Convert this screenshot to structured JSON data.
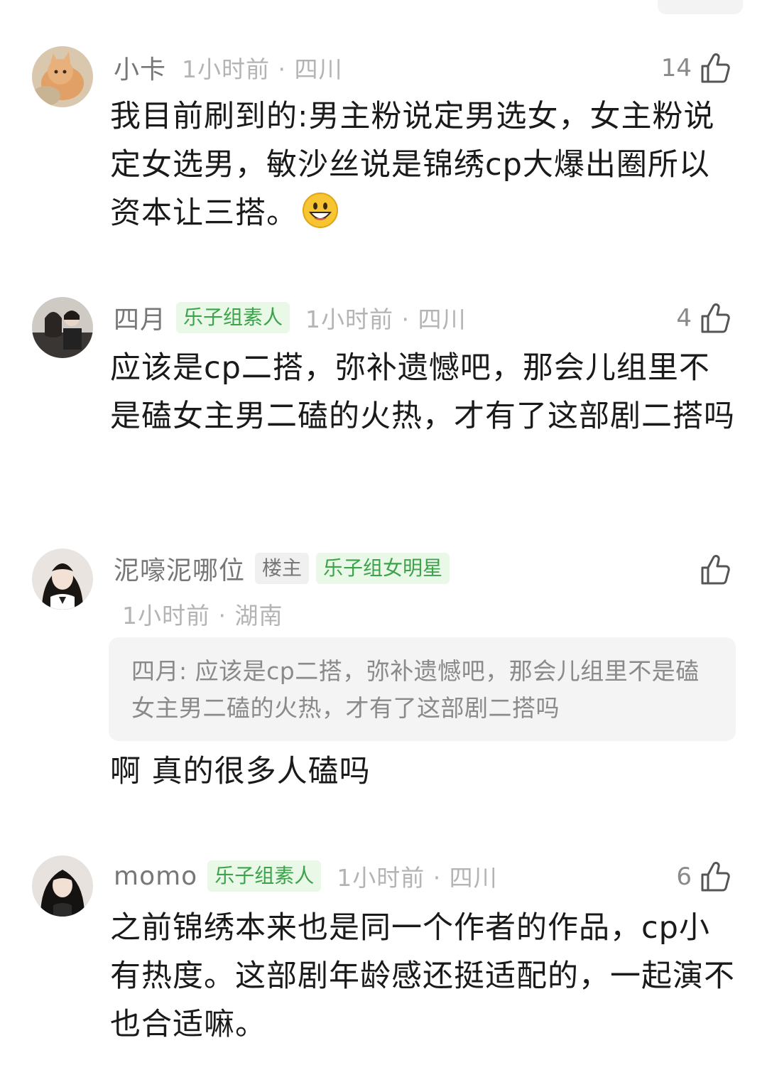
{
  "colors": {
    "badge_green_bg": "#e9f8e7",
    "badge_green_text": "#3ca34b",
    "username": "#777777",
    "meta_time": "#b4b4b4"
  },
  "comments": [
    {
      "username": "小卡",
      "badges": [],
      "time_location": "1小时前 · 四川",
      "likes": "14",
      "text": "我目前刷到的:男主粉说定男选女，女主粉说定女选男，敏沙丝说是锦绣cp大爆出圈所以资本让三搭。",
      "emoji": "grinning-face-emoji",
      "avatar": "cat-photo"
    },
    {
      "username": "四月",
      "badges": [
        "乐子组素人"
      ],
      "time_location": "1小时前 · 四川",
      "likes": "4",
      "text": "应该是cp二搭，弥补遗憾吧，那会儿组里不是磕女主男二磕的火热，才有了这部剧二搭吗",
      "avatar": "couple-photo"
    },
    {
      "username": "泥嚎泥哪位",
      "badges": [
        "楼主",
        "乐子组女明星"
      ],
      "time_location": "1小时前 · 湖南",
      "likes": "",
      "quote_author": "四月:",
      "quote_text": " 应该是cp二搭，弥补遗憾吧，那会儿组里不是磕女主男二磕的火热，才有了这部剧二搭吗",
      "text": "啊 真的很多人磕吗",
      "avatar": "girl-photo"
    },
    {
      "username": "momo",
      "badges": [
        "乐子组素人"
      ],
      "time_location": "1小时前 · 四川",
      "likes": "6",
      "text": "之前锦绣本来也是同一个作者的作品，cp小有热度。这部剧年龄感还挺适配的，一起演不也合适嘛。",
      "avatar": "woman-photo"
    }
  ]
}
